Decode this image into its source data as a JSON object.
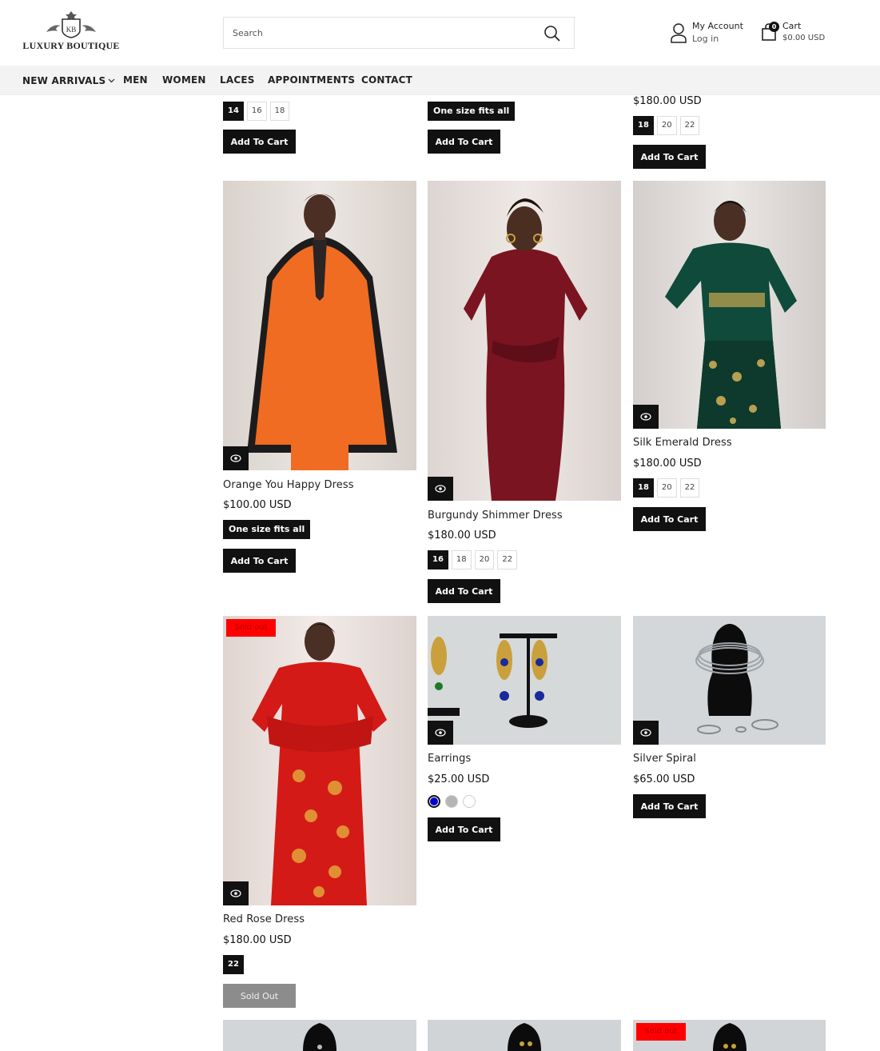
{
  "brand": {
    "logo_text": "LUXURY BOUTIQUE"
  },
  "search": {
    "placeholder": "Search"
  },
  "account": {
    "title": "My Account",
    "link": "Log in"
  },
  "cart": {
    "title": "Cart",
    "count": "0",
    "total": "$0.00 USD"
  },
  "nav": {
    "items": [
      "NEW ARRIVALS",
      "MEN",
      "WOMEN",
      "LACES",
      "APPOINTMENTS",
      "CONTACT"
    ]
  },
  "icons": {
    "search": "search-icon",
    "account": "user-icon",
    "cart": "shopping-bag-icon",
    "quick_view": "eye-icon",
    "dropdown": "chevron-down-icon"
  },
  "colors": {
    "primary": "#111111",
    "sold_badge": "#ff0000",
    "nav_bg": "#f3f3f3"
  },
  "products_top": [
    {
      "sizes": [
        "14",
        "16",
        "18"
      ],
      "active": "14",
      "button": "Add To Cart"
    },
    {
      "sizes": [
        "One size fits all"
      ],
      "active": "One size fits all",
      "button": "Add To Cart"
    },
    {
      "price": "$180.00 USD",
      "sizes": [
        "18",
        "20",
        "22"
      ],
      "active": "18",
      "button": "Add To Cart"
    }
  ],
  "products": [
    {
      "title": "Orange You Happy Dress",
      "price": "$100.00 USD",
      "sizes": [
        "One size fits all"
      ],
      "active": "One size fits all",
      "button": "Add To Cart"
    },
    {
      "title": "Burgundy Shimmer Dress",
      "price": "$180.00 USD",
      "sizes": [
        "16",
        "18",
        "20",
        "22"
      ],
      "active": "16",
      "button": "Add To Cart"
    },
    {
      "title": "Silk Emerald Dress",
      "price": "$180.00 USD",
      "sizes": [
        "18",
        "20",
        "22"
      ],
      "active": "18",
      "button": "Add To Cart"
    },
    {
      "title": "Red Rose Dress",
      "price": "$180.00 USD",
      "sizes": [
        "22"
      ],
      "active": "22",
      "button": "Sold Out",
      "badge": "Sold out"
    },
    {
      "title": "Earrings",
      "price": "$25.00 USD",
      "colors": [
        "#0000cc",
        "#b5b5b5",
        "#ffffff"
      ],
      "button": "Add To Cart"
    },
    {
      "title": "Silver Spiral",
      "price": "$65.00 USD",
      "button": "Add To Cart"
    }
  ],
  "products_bottom": [
    {
      "badge": ""
    },
    {
      "badge": ""
    },
    {
      "badge": "Sold out"
    }
  ]
}
